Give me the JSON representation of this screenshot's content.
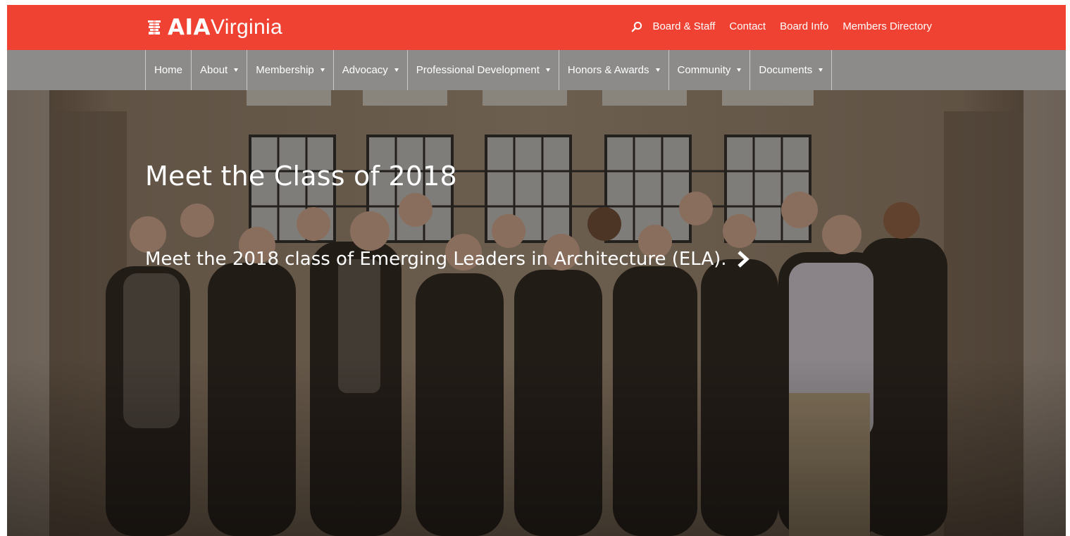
{
  "brand": {
    "logo_strong": "AIA",
    "logo_light": "Virginia",
    "accent_color": "#f04232",
    "nav_color": "#8c8b8a"
  },
  "utility_nav": {
    "search_icon": "search-icon",
    "links": [
      "Board & Staff",
      "Contact",
      "Board Info",
      "Members Directory"
    ]
  },
  "main_nav": {
    "items": [
      {
        "label": "Home",
        "has_dropdown": false
      },
      {
        "label": "About",
        "has_dropdown": true
      },
      {
        "label": "Membership",
        "has_dropdown": true
      },
      {
        "label": "Advocacy",
        "has_dropdown": true
      },
      {
        "label": "Professional Development",
        "has_dropdown": true
      },
      {
        "label": "Honors & Awards",
        "has_dropdown": true
      },
      {
        "label": "Community",
        "has_dropdown": true
      },
      {
        "label": "Documents",
        "has_dropdown": true
      }
    ]
  },
  "hero": {
    "title": "Meet the Class of 2018",
    "subtitle": "Meet the 2018 class of Emerging Leaders in Architecture (ELA).",
    "link_icon": "chevron-right-icon"
  }
}
